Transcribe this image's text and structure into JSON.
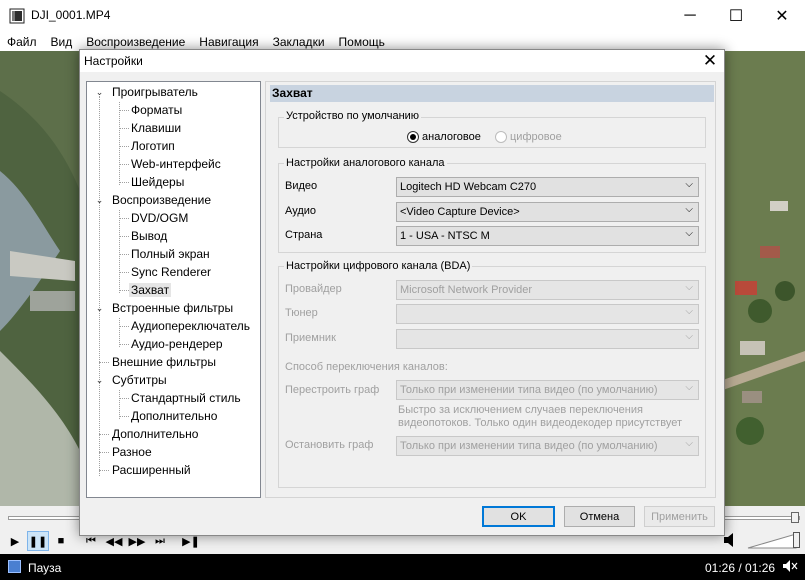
{
  "window": {
    "title": "DJI_0001.MP4",
    "controls": {
      "minimize": "─",
      "maximize": "☐",
      "close": "✕"
    }
  },
  "menu": [
    "Файл",
    "Вид",
    "Воспроизведение",
    "Навигация",
    "Закладки",
    "Помощь"
  ],
  "dialog": {
    "title": "Настройки",
    "close": "✕",
    "tree": [
      {
        "label": "Проигрыватель",
        "level": 0,
        "expanded": true
      },
      {
        "label": "Форматы",
        "level": 1
      },
      {
        "label": "Клавиши",
        "level": 1
      },
      {
        "label": "Логотип",
        "level": 1
      },
      {
        "label": "Web-интерфейс",
        "level": 1
      },
      {
        "label": "Шейдеры",
        "level": 1
      },
      {
        "label": "Воспроизведение",
        "level": 0,
        "expanded": true
      },
      {
        "label": "DVD/OGM",
        "level": 1
      },
      {
        "label": "Вывод",
        "level": 1
      },
      {
        "label": "Полный экран",
        "level": 1
      },
      {
        "label": "Sync Renderer",
        "level": 1
      },
      {
        "label": "Захват",
        "level": 1,
        "selected": true
      },
      {
        "label": "Встроенные фильтры",
        "level": 0,
        "expanded": true
      },
      {
        "label": "Аудиопереключатель",
        "level": 1
      },
      {
        "label": "Аудио-рендерер",
        "level": 1
      },
      {
        "label": "Внешние фильтры",
        "level": 0
      },
      {
        "label": "Субтитры",
        "level": 0,
        "expanded": true
      },
      {
        "label": "Стандартный стиль",
        "level": 1
      },
      {
        "label": "Дополнительно",
        "level": 1
      },
      {
        "label": "Дополнительно",
        "level": 0
      },
      {
        "label": "Разное",
        "level": 0
      },
      {
        "label": "Расширенный",
        "level": 0
      }
    ],
    "panel": {
      "title": "Захват",
      "default_device": {
        "legend": "Устройство по умолчанию",
        "analog": "аналоговое",
        "digital": "цифровое",
        "selected": "analog"
      },
      "analog": {
        "legend": "Настройки аналогового канала",
        "video_label": "Видео",
        "video_value": "Logitech HD Webcam C270",
        "audio_label": "Аудио",
        "audio_value": "<Video Capture Device>",
        "country_label": "Страна",
        "country_value": "1 - USA - NTSC M"
      },
      "digital": {
        "legend": "Настройки цифрового канала (BDA)",
        "provider_label": "Провайдер",
        "provider_value": "Microsoft Network Provider",
        "tuner_label": "Тюнер",
        "tuner_value": "",
        "receiver_label": "Приемник",
        "receiver_value": "",
        "switch_label": "Способ переключения каналов:",
        "rebuild_label": "Перестроить граф",
        "rebuild_value": "Только при изменении типа видео (по умолчанию)",
        "hint_line1": "Быстро за исключением случаев переключения",
        "hint_line2": "видеопотоков. Только один видеодекодер присутствует",
        "stop_label": "Остановить граф",
        "stop_value": "Только при изменении типа видео (по умолчанию)"
      }
    },
    "buttons": {
      "ok": "OK",
      "cancel": "Отмена",
      "apply": "Применить"
    }
  },
  "player": {
    "controls": [
      "▶",
      "❚❚",
      "■",
      "⏮",
      "◀◀",
      "▶▶",
      "⏭",
      "▶❚"
    ],
    "status": "Пауза",
    "time": "01:26 / 01:26",
    "seek_fraction": 1.0,
    "volume_fraction": 1.0
  },
  "colors": {
    "accent": "#0078d7",
    "panel_header": "#c8d3e0",
    "status_bg": "#000000"
  },
  "icons": {
    "app": "mpc-app-icon",
    "volume": "volume-icon",
    "status": "status-icon"
  }
}
